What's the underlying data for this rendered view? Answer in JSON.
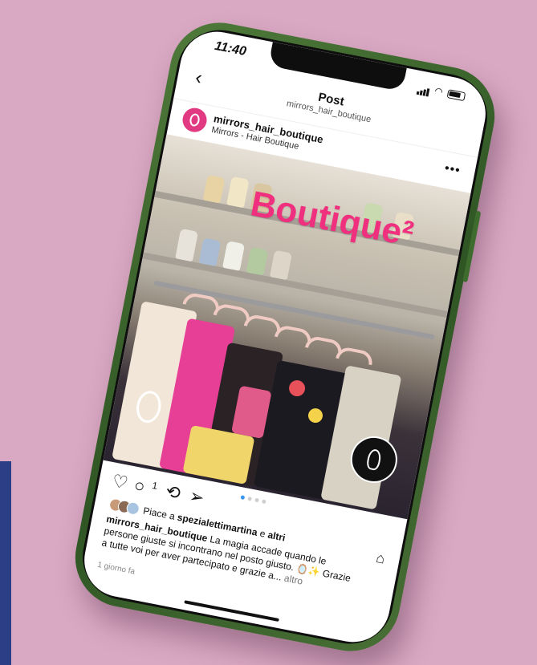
{
  "status": {
    "time": "11:40"
  },
  "nav": {
    "title": "Post",
    "subtitle": "mirrors_hair_boutique"
  },
  "post": {
    "username": "mirrors_hair_boutique",
    "fullname": "Mirrors - Hair Boutique",
    "image_title": "Boutique²",
    "comments_count": "1",
    "likes": {
      "prefix": "Piace a",
      "user": "spezialettimartina",
      "conj": "e",
      "others": "altri"
    },
    "caption": {
      "username": "mirrors_hair_boutique",
      "text": "La magia accade quando le persone giuste si incontrano nel posto giusto. 🪞✨ Grazie a tutte voi per aver partecipato e grazie a...",
      "more": "altro"
    },
    "date": "1 giorno fa"
  },
  "icons": {
    "back": "chevron-left-icon",
    "more": "more-dots-icon",
    "like": "heart-icon",
    "comment": "comment-icon",
    "repost": "repost-icon",
    "share": "send-icon",
    "save": "bookmark-icon"
  },
  "colors": {
    "background": "#d9a8c3",
    "phone_frame": "#2f5524",
    "accent": "#f0307e",
    "avatar": "#e23a82",
    "dot_active": "#3897f0"
  },
  "carousel": {
    "active_index": 0,
    "count": 4
  }
}
